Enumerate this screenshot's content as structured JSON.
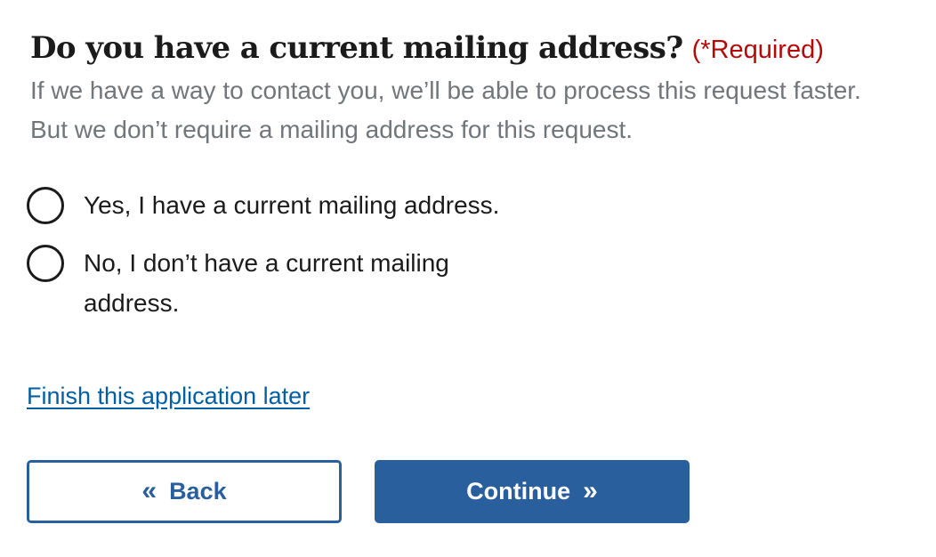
{
  "question": {
    "title": "Do you have a current mailing address?",
    "required_label": "(*Required)",
    "hint": "If we have a way to contact you, we’ll be able to process this request faster. But we don’t require a mailing address for this request."
  },
  "options": [
    {
      "label": "Yes, I have a current mailing address.",
      "selected": false
    },
    {
      "label": "No, I don’t have a current mailing address.",
      "selected": false
    }
  ],
  "save_link": {
    "label": "Finish this application later"
  },
  "buttons": {
    "back_label": "Back",
    "back_icon": "«",
    "continue_label": "Continue",
    "continue_icon": "»"
  },
  "colors": {
    "primary": "#2a5f9e",
    "link": "#005ea2",
    "required": "#b50909",
    "hint": "#71767a",
    "text": "#1b1b1b"
  }
}
